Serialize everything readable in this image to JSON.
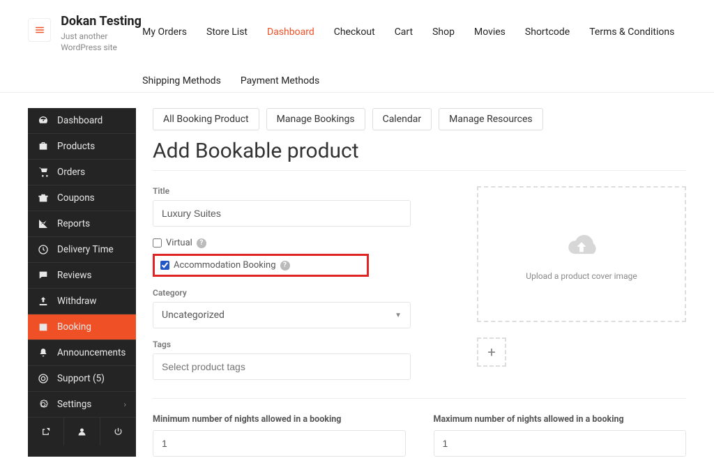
{
  "site": {
    "title": "Dokan Testing",
    "tagline": "Just another WordPress site"
  },
  "nav": {
    "my_orders": "My Orders",
    "store_list": "Store List",
    "dashboard": "Dashboard",
    "checkout": "Checkout",
    "cart": "Cart",
    "shop": "Shop",
    "movies": "Movies",
    "shortcode": "Shortcode",
    "terms": "Terms & Conditions",
    "shipping": "Shipping Methods",
    "payment": "Payment Methods",
    "active": "dashboard"
  },
  "sidebar": {
    "items": [
      {
        "key": "dashboard",
        "label": "Dashboard",
        "icon": "gauge"
      },
      {
        "key": "products",
        "label": "Products",
        "icon": "briefcase"
      },
      {
        "key": "orders",
        "label": "Orders",
        "icon": "cart"
      },
      {
        "key": "coupons",
        "label": "Coupons",
        "icon": "gift"
      },
      {
        "key": "reports",
        "label": "Reports",
        "icon": "chart"
      },
      {
        "key": "delivery",
        "label": "Delivery Time",
        "icon": "clock"
      },
      {
        "key": "reviews",
        "label": "Reviews",
        "icon": "comment"
      },
      {
        "key": "withdraw",
        "label": "Withdraw",
        "icon": "upload"
      },
      {
        "key": "booking",
        "label": "Booking",
        "icon": "calendar"
      },
      {
        "key": "announce",
        "label": "Announcements",
        "icon": "bell"
      },
      {
        "key": "support",
        "label": "Support (5)",
        "icon": "life-ring"
      },
      {
        "key": "settings",
        "label": "Settings",
        "icon": "gear"
      }
    ],
    "active": "booking"
  },
  "tabs": {
    "all": "All Booking Product",
    "manage": "Manage Bookings",
    "calendar": "Calendar",
    "resources": "Manage Resources"
  },
  "page": {
    "title": "Add Bookable product"
  },
  "form": {
    "title_label": "Title",
    "title_value": "Luxury Suites",
    "virtual_label": "Virtual",
    "virtual_checked": false,
    "accomm_label": "Accommodation Booking",
    "accomm_checked": true,
    "category_label": "Category",
    "category_value": "Uncategorized",
    "tags_label": "Tags",
    "tags_placeholder": "Select product tags",
    "upload_caption": "Upload a product cover image",
    "min_label": "Minimum number of nights allowed in a booking",
    "min_value": "1",
    "max_label": "Maximum number of nights allowed in a booking",
    "max_value": "1"
  }
}
